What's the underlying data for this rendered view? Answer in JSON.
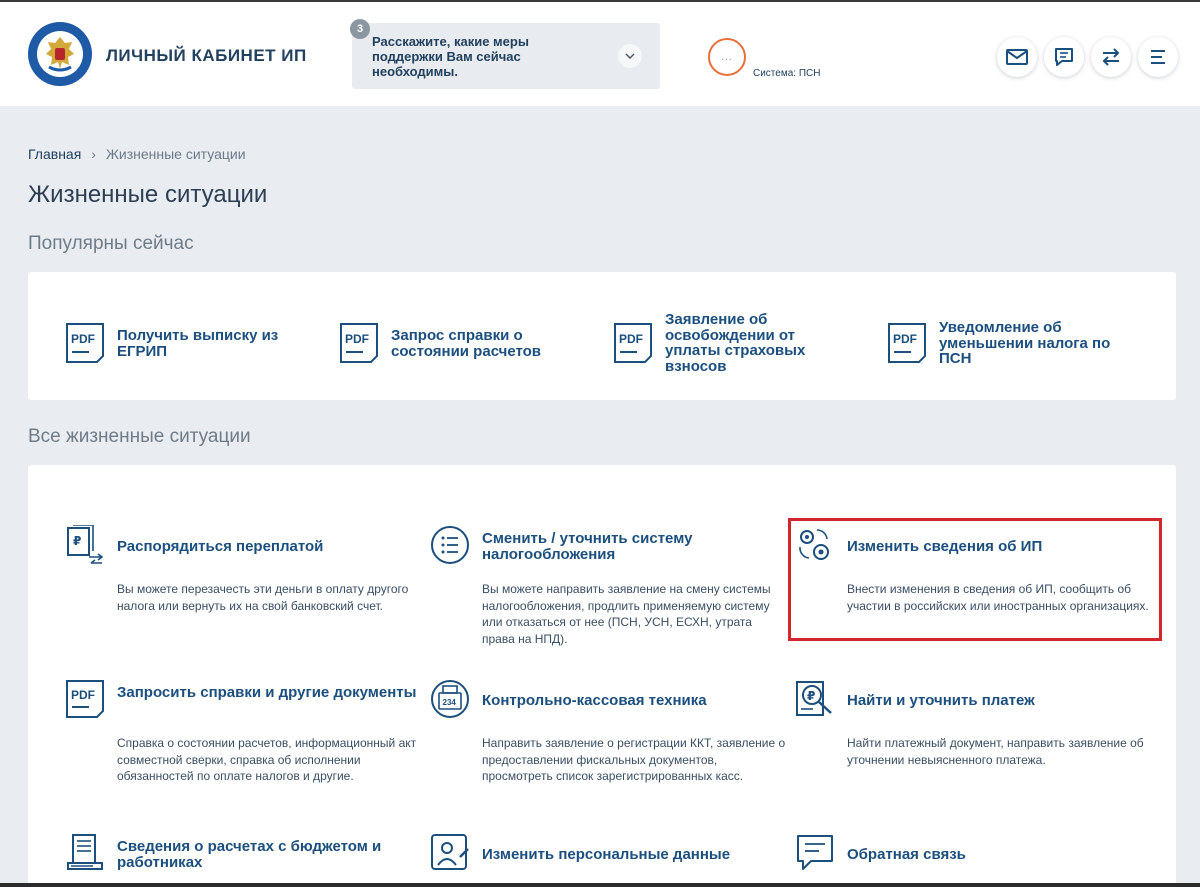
{
  "header": {
    "brand": "ЛИЧНЫЙ КАБИНЕТ ИП",
    "survey": {
      "badge": "3",
      "text": "Расскажите, какие меры поддержки Вам сейчас необходимы."
    },
    "profile_placeholder": "...",
    "tax_system": "Система: ПСН",
    "icons": [
      "mail-icon",
      "chat-icon",
      "transfer-icon",
      "menu-icon"
    ]
  },
  "breadcrumb": {
    "home": "Главная",
    "current": "Жизненные ситуации"
  },
  "page_title": "Жизненные ситуации",
  "popular": {
    "title": "Популярны сейчас",
    "items": [
      {
        "label": "Получить выписку из ЕГРИП"
      },
      {
        "label": "Запрос справки о состоянии расчетов"
      },
      {
        "label": "Заявление об освобождении от уплаты страховых взносов"
      },
      {
        "label": "Уведомление об уменьшении налога по ПСН"
      }
    ]
  },
  "all": {
    "title": "Все жизненные ситуации",
    "items": [
      {
        "title": "Распорядиться переплатой",
        "desc": "Вы можете перезачесть эти деньги в оплату другого налога или вернуть их на свой банковский счет."
      },
      {
        "title": "Сменить / уточнить систему налогообложения",
        "desc": "Вы можете направить заявление на смену системы налогообложения, продлить применяемую систему или отказаться от нее (ПСН, УСН, ЕСХН, утрата права на НПД)."
      },
      {
        "title": "Изменить сведения об ИП",
        "desc": "Внести изменения в сведения об ИП, сообщить об участии в российских или иностранных организациях."
      },
      {
        "title": "Запросить справки и другие документы",
        "desc": "Справка о состоянии расчетов, информационный акт совместной сверки, справка об исполнении обязанностей по оплате налогов и другие."
      },
      {
        "title": "Контрольно-кассовая техника",
        "desc": "Направить заявление о регистрации ККТ, заявление о предоставлении фискальных документов, просмотреть список зарегистрированных касс.",
        "icon_text": "234"
      },
      {
        "title": "Найти и уточнить платеж",
        "desc": "Найти платежный документ, направить заявление об уточнении невыясненного платежа."
      },
      {
        "title": "Сведения о расчетах с бюджетом и работниках",
        "desc": ""
      },
      {
        "title": "Изменить персональные данные",
        "desc": ""
      },
      {
        "title": "Обратная связь",
        "desc": ""
      }
    ]
  },
  "icon_labels": {
    "pdf": "PDF"
  },
  "colors": {
    "accent": "#1b4f7e",
    "highlight": "#d3262a",
    "profile_ring": "#e8703a"
  }
}
